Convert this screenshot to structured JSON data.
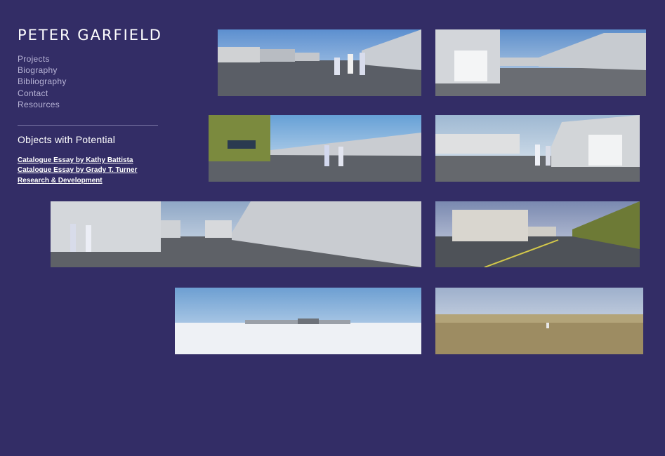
{
  "site": {
    "title": "PETER GARFIELD"
  },
  "nav": [
    {
      "label": "Projects"
    },
    {
      "label": "Biography"
    },
    {
      "label": "Bibliography"
    },
    {
      "label": "Contact"
    },
    {
      "label": "Resources"
    }
  ],
  "project": {
    "title": "Objects with Potential",
    "links": [
      {
        "label": "Catalogue Essay by Kathy Battista"
      },
      {
        "label": "Catalogue Essay by Grady T. Turner"
      },
      {
        "label": "Research & Development"
      }
    ]
  },
  "colors": {
    "background": "#332d66",
    "title_text": "#ffffff",
    "nav_text": "#b8b4d6",
    "divider": "#7a75a4"
  }
}
